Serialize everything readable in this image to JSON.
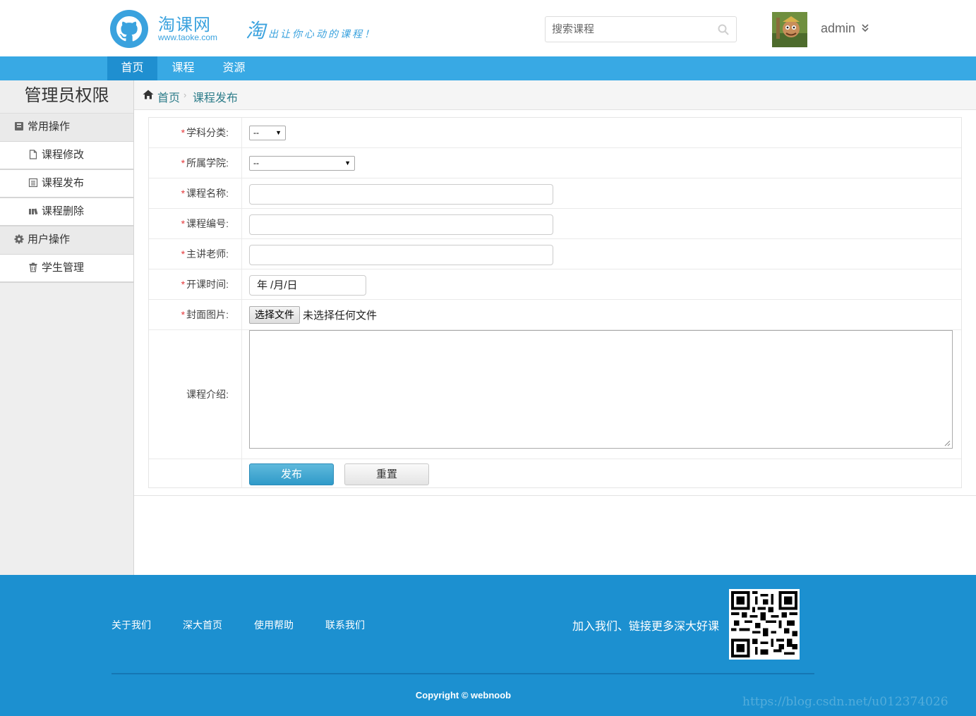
{
  "header": {
    "logo_name": "淘课网",
    "logo_url": "www.taoke.com",
    "slogan_big": "淘",
    "slogan_small": "出让你心动的课程！",
    "search_placeholder": "搜索课程",
    "username": "admin"
  },
  "nav": {
    "items": [
      {
        "label": "首页",
        "active": true
      },
      {
        "label": "课程",
        "active": false
      },
      {
        "label": "资源",
        "active": false
      }
    ]
  },
  "sidebar": {
    "title": "管理员权限",
    "groups": [
      {
        "label": "常用操作",
        "icon": "book-icon",
        "items": [
          {
            "label": "课程修改",
            "icon": "file-icon"
          },
          {
            "label": "课程发布",
            "icon": "list-icon"
          },
          {
            "label": "课程删除",
            "icon": "books-icon"
          }
        ]
      },
      {
        "label": "用户操作",
        "icon": "gear-icon",
        "items": [
          {
            "label": "学生管理",
            "icon": "trash-icon"
          }
        ]
      }
    ]
  },
  "breadcrumb": {
    "home": "首页",
    "separator": "›",
    "current": "课程发布"
  },
  "form": {
    "required_mark": "*",
    "subject": {
      "label": "学科分类:",
      "value": "--"
    },
    "college": {
      "label": "所属学院:",
      "value": "--"
    },
    "course_name": {
      "label": "课程名称:",
      "value": ""
    },
    "course_code": {
      "label": "课程编号:",
      "value": ""
    },
    "teacher": {
      "label": "主讲老师:",
      "value": ""
    },
    "start_date": {
      "label": "开课时间:",
      "value": "年 /月/日"
    },
    "cover": {
      "label": "封面图片:",
      "button": "选择文件",
      "status": "未选择任何文件"
    },
    "intro": {
      "label": "课程介绍:",
      "value": ""
    },
    "publish_button": "发布",
    "reset_button": "重置"
  },
  "footer": {
    "links": [
      "关于我们",
      "深大首页",
      "使用帮助",
      "联系我们"
    ],
    "join_text": "加入我们、链接更多深大好课",
    "copyright": "Copyright © webnoob",
    "watermark": "https://blog.csdn.net/u012374026"
  },
  "colors": {
    "brand_blue": "#38a9e4",
    "nav_active": "#1f8fd0",
    "footer_blue": "#1c90d0",
    "required_red": "#e4393c"
  }
}
